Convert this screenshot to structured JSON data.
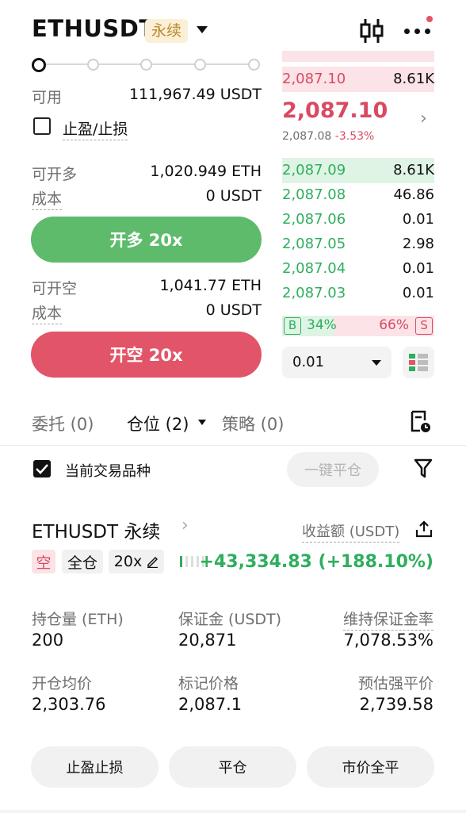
{
  "header": {
    "symbol": "ETHUSDT",
    "contract_badge": "永续"
  },
  "order_form": {
    "available_label": "可用",
    "available_value": "111,967.49 USDT",
    "tpsl_label": "止盈/止损",
    "long": {
      "max_label": "可开多",
      "max_value": "1,020.949 ETH",
      "cost_label": "成本",
      "cost_value": "0 USDT",
      "button": "开多 20x"
    },
    "short": {
      "max_label": "可开空",
      "max_value": "1,041.77 ETH",
      "cost_label": "成本",
      "cost_value": "0 USDT",
      "button": "开空 20x"
    }
  },
  "orderbook": {
    "asks": [
      {
        "price": "2,087.10",
        "qty": "8.61K"
      }
    ],
    "last_price": "2,087.10",
    "mark_price": "2,087.08",
    "change": "-3.53%",
    "bids": [
      {
        "price": "2,087.09",
        "qty": "8.61K"
      },
      {
        "price": "2,087.08",
        "qty": "46.86"
      },
      {
        "price": "2,087.06",
        "qty": "0.01"
      },
      {
        "price": "2,087.05",
        "qty": "2.98"
      },
      {
        "price": "2,087.04",
        "qty": "0.01"
      },
      {
        "price": "2,087.03",
        "qty": "0.01"
      }
    ],
    "buy_label": "B",
    "buy_pct": "34%",
    "sell_pct": "66%",
    "sell_label": "S",
    "buy_ratio": 0.34,
    "precision": "0.01"
  },
  "tabs": {
    "orders": "委托 (0)",
    "positions": "仓位 (2)",
    "strategy": "策略 (0)"
  },
  "filter": {
    "current_symbol_label": "当前交易品种",
    "close_all_label": "一键平仓"
  },
  "position": {
    "title": "ETHUSDT 永续",
    "pnl_label": "收益额 (USDT)",
    "side": "空",
    "margin_mode": "全仓",
    "leverage": "20x",
    "pnl_value": "+43,334.83 (+188.10%)",
    "stats": [
      {
        "label": "持仓量 (ETH)",
        "value": "200"
      },
      {
        "label": "保证金 (USDT)",
        "value": "20,871"
      },
      {
        "label": "维持保证金率",
        "value": "7,078.53%"
      },
      {
        "label": "开仓均价",
        "value": "2,303.76"
      },
      {
        "label": "标记价格",
        "value": "2,087.1"
      },
      {
        "label": "预估强平价",
        "value": "2,739.58"
      }
    ],
    "actions": {
      "tpsl": "止盈止损",
      "close": "平仓",
      "market_close": "市价全平"
    }
  },
  "colors": {
    "buy_green": "#2eae5e",
    "sell_red": "#d94a62",
    "long_button": "#5dbb6b",
    "short_button": "#e25468"
  }
}
